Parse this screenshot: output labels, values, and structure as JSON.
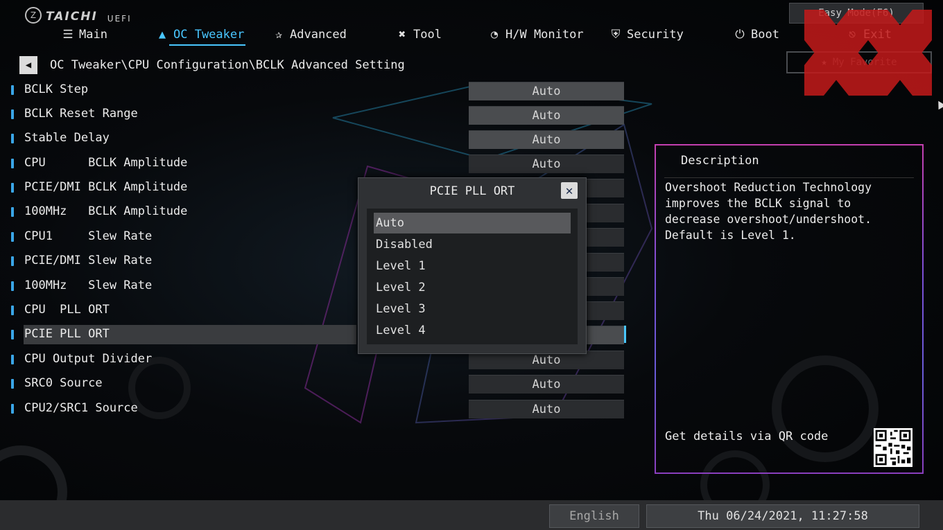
{
  "header": {
    "brand": "TAICHI",
    "brand_suffix": "UEFI",
    "easy_mode": "Easy Mode(F6)",
    "favorite": "My Favorite"
  },
  "nav": [
    {
      "label": "Main",
      "icon": "list-icon"
    },
    {
      "label": "OC Tweaker",
      "icon": "rocket-icon",
      "active": true
    },
    {
      "label": "Advanced",
      "icon": "star-advanced-icon"
    },
    {
      "label": "Tool",
      "icon": "wrench-icon"
    },
    {
      "label": "H/W Monitor",
      "icon": "monitor-icon"
    },
    {
      "label": "Security",
      "icon": "shield-icon"
    },
    {
      "label": "Boot",
      "icon": "power-icon"
    },
    {
      "label": "Exit",
      "icon": "exit-icon"
    }
  ],
  "breadcrumb": "OC Tweaker\\CPU Configuration\\BCLK Advanced Setting",
  "settings": [
    {
      "label": "BCLK Step",
      "value": "Auto"
    },
    {
      "label": "BCLK Reset Range",
      "value": "Auto"
    },
    {
      "label": "Stable Delay",
      "value": "Auto"
    },
    {
      "label": "CPU      BCLK Amplitude",
      "value": "Auto"
    },
    {
      "label": "PCIE/DMI BCLK Amplitude",
      "value": "Auto"
    },
    {
      "label": "100MHz   BCLK Amplitude",
      "value": ""
    },
    {
      "label": "CPU1     Slew Rate",
      "value": ""
    },
    {
      "label": "PCIE/DMI Slew Rate",
      "value": ""
    },
    {
      "label": "100MHz   Slew Rate",
      "value": ""
    },
    {
      "label": "CPU  PLL ORT",
      "value": ""
    },
    {
      "label": "PCIE PLL ORT",
      "value": "",
      "selected": true
    },
    {
      "label": "CPU Output Divider",
      "value": "Auto"
    },
    {
      "label": "SRC0 Source",
      "value": "Auto"
    },
    {
      "label": "CPU2/SRC1 Source",
      "value": "Auto"
    }
  ],
  "popup": {
    "title": "PCIE PLL ORT",
    "close": "✕",
    "options": [
      "Auto",
      "Disabled",
      "Level 1",
      "Level 2",
      "Level 3",
      "Level 4"
    ],
    "selected": "Auto"
  },
  "description": {
    "title": "Description",
    "text": "Overshoot Reduction Technology improves the BCLK signal to decrease overshoot/undershoot. Default is Level 1.",
    "qr_label": "Get details via QR code"
  },
  "footer": {
    "language": "English",
    "datetime": "Thu 06/24/2021, 11:27:58"
  }
}
